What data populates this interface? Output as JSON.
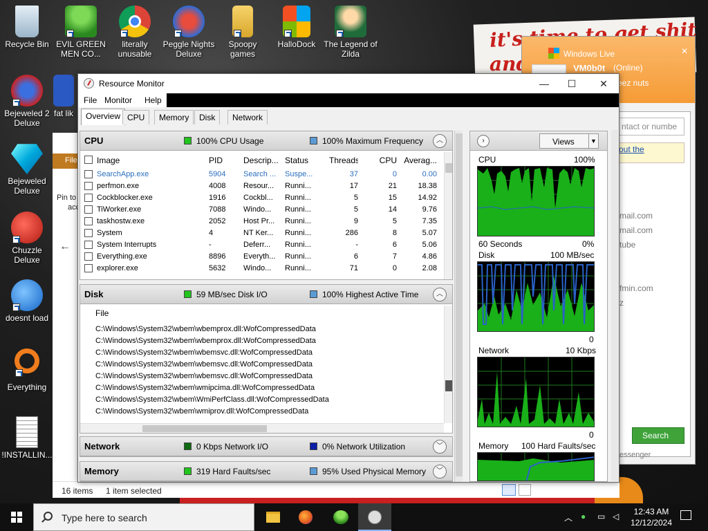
{
  "desktop": {
    "icons": [
      {
        "label": "Recycle Bin"
      },
      {
        "label": "EVIL GREEN MEN CO..."
      },
      {
        "label": "literally unusable"
      },
      {
        "label": "Peggle Nights Deluxe"
      },
      {
        "label": "Spoopy games"
      },
      {
        "label": "HalloDock"
      },
      {
        "label": "The Legend of Zilda"
      },
      {
        "label": "Bejeweled 2 Deluxe"
      },
      {
        "label": "fat lik"
      },
      {
        "label": "Bejeweled Deluxe"
      },
      {
        "label": "Chuzzle Deluxe"
      },
      {
        "label": "doesnt load"
      },
      {
        "label": "Everything"
      },
      {
        "label": "!INSTALLIN..."
      }
    ],
    "bg_text_1": "it's time to get shit",
    "bg_text_2": "and"
  },
  "explorer": {
    "strip_label": "File",
    "pin_label_1": "Pin to",
    "pin_label_2": "acc",
    "status_items": "16 items",
    "status_selected": "1 item selected"
  },
  "messenger": {
    "title": "Windows Live",
    "name": "VM0b0t",
    "status": "(Online)",
    "message": "eez nuts",
    "search_placeholder": "ntact or numbe",
    "tip_text": "out the",
    "contacts": [
      "mail.com",
      "mail.com",
      "tube",
      "fmin.com",
      "z"
    ],
    "search_label": "Search",
    "footer": "essenger"
  },
  "resource_monitor": {
    "title": "Resource Monitor",
    "menu": [
      "File",
      "Monitor",
      "Help"
    ],
    "tabs": [
      "Overview",
      "CPU",
      "Memory",
      "Disk",
      "Network"
    ],
    "colors": {
      "green": "#22c41e",
      "blue": "#5b9bd5",
      "darkgreen": "#0f6b12",
      "navy": "#0a1ea8"
    },
    "cpu": {
      "title": "CPU",
      "stat1": "100% CPU Usage",
      "stat2": "100% Maximum Frequency",
      "columns": [
        "Image",
        "PID",
        "Descrip...",
        "Status",
        "Threads",
        "CPU",
        "Averag..."
      ],
      "rows": [
        {
          "image": "SearchApp.exe",
          "pid": "5904",
          "desc": "Search ...",
          "status": "Suspe...",
          "threads": "37",
          "cpu": "0",
          "avg": "0.00"
        },
        {
          "image": "perfmon.exe",
          "pid": "4008",
          "desc": "Resour...",
          "status": "Runni...",
          "threads": "17",
          "cpu": "21",
          "avg": "18.38"
        },
        {
          "image": "Cockblocker.exe",
          "pid": "1916",
          "desc": "Cockbl...",
          "status": "Runni...",
          "threads": "5",
          "cpu": "15",
          "avg": "14.92"
        },
        {
          "image": "TiWorker.exe",
          "pid": "7088",
          "desc": "Windo...",
          "status": "Runni...",
          "threads": "5",
          "cpu": "14",
          "avg": "9.76"
        },
        {
          "image": "taskhostw.exe",
          "pid": "2052",
          "desc": "Host Pr...",
          "status": "Runni...",
          "threads": "9",
          "cpu": "5",
          "avg": "7.35"
        },
        {
          "image": "System",
          "pid": "4",
          "desc": "NT Ker...",
          "status": "Runni...",
          "threads": "286",
          "cpu": "8",
          "avg": "5.07"
        },
        {
          "image": "System Interrupts",
          "pid": "-",
          "desc": "Deferr...",
          "status": "Runni...",
          "threads": "-",
          "cpu": "6",
          "avg": "5.06"
        },
        {
          "image": "Everything.exe",
          "pid": "8896",
          "desc": "Everyth...",
          "status": "Runni...",
          "threads": "6",
          "cpu": "7",
          "avg": "4.86"
        },
        {
          "image": "explorer.exe",
          "pid": "5632",
          "desc": "Windo...",
          "status": "Runni...",
          "threads": "71",
          "cpu": "0",
          "avg": "2.08"
        }
      ]
    },
    "disk": {
      "title": "Disk",
      "stat1": "59 MB/sec Disk I/O",
      "stat2": "100% Highest Active Time",
      "column": "File",
      "files": [
        "C:\\Windows\\System32\\wbem\\wbemprox.dll:WofCompressedData",
        "C:\\Windows\\System32\\wbem\\wbemprox.dll:WofCompressedData",
        "C:\\Windows\\System32\\wbem\\wbemsvc.dll:WofCompressedData",
        "C:\\Windows\\System32\\wbem\\wbemsvc.dll:WofCompressedData",
        "C:\\Windows\\System32\\wbem\\wbemsvc.dll:WofCompressedData",
        "C:\\Windows\\System32\\wbem\\wmipcima.dll:WofCompressedData",
        "C:\\Windows\\System32\\wbem\\WmiPerfClass.dll:WofCompressedData",
        "C:\\Windows\\System32\\wbem\\wmiprov.dll:WofCompressedData"
      ]
    },
    "network": {
      "title": "Network",
      "stat1": "0 Kbps Network I/O",
      "stat2": "0% Network Utilization"
    },
    "memory": {
      "title": "Memory",
      "stat1": "319 Hard Faults/sec",
      "stat2": "95% Used Physical Memory"
    },
    "graphs": {
      "views_label": "Views",
      "cpu_label": "CPU",
      "cpu_max": "100%",
      "cpu_time": "60 Seconds",
      "cpu_min": "0%",
      "disk_label": "Disk",
      "disk_max": "100 MB/sec",
      "disk_min": "0",
      "net_label": "Network",
      "net_max": "10 Kbps",
      "net_min": "0",
      "mem_label": "Memory",
      "mem_max": "100 Hard Faults/sec"
    }
  },
  "taskbar": {
    "search_placeholder": "Type here to search",
    "time": "12:43 AM",
    "date": "12/12/2024"
  }
}
